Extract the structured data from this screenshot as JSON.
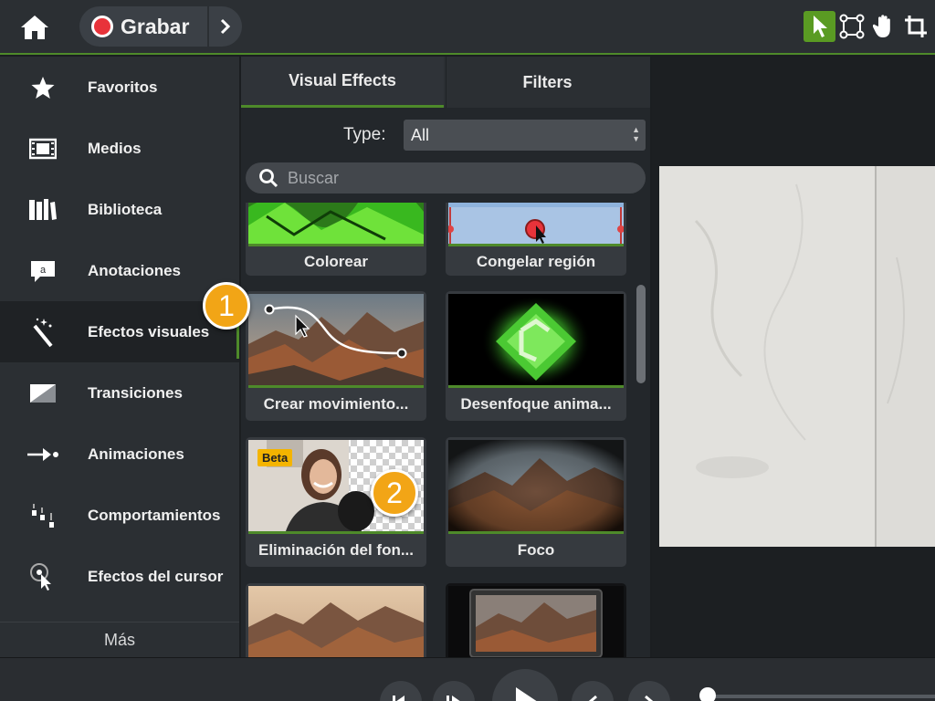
{
  "topbar": {
    "record_label": "Grabar",
    "tools": [
      "pointer-icon",
      "transform-icon",
      "hand-icon",
      "crop-icon"
    ]
  },
  "sidebar": {
    "items": [
      {
        "label": "Favoritos",
        "icon": "star-icon"
      },
      {
        "label": "Medios",
        "icon": "film-icon"
      },
      {
        "label": "Biblioteca",
        "icon": "library-icon"
      },
      {
        "label": "Anotaciones",
        "icon": "annotation-icon"
      },
      {
        "label": "Efectos visuales",
        "icon": "magic-wand-icon",
        "active": true
      },
      {
        "label": "Transiciones",
        "icon": "transition-icon"
      },
      {
        "label": "Animaciones",
        "icon": "animation-icon"
      },
      {
        "label": "Comportamientos",
        "icon": "behaviors-icon"
      },
      {
        "label": "Efectos del cursor",
        "icon": "cursor-effects-icon"
      }
    ],
    "more_label": "Más"
  },
  "panel": {
    "tabs": [
      {
        "label": "Visual Effects",
        "active": true
      },
      {
        "label": "Filters"
      }
    ],
    "type_label": "Type:",
    "type_value": "All",
    "search_placeholder": "Buscar",
    "effects": [
      {
        "label": "Colorear"
      },
      {
        "label": "Congelar región"
      },
      {
        "label": "Crear movimiento..."
      },
      {
        "label": "Desenfoque anima..."
      },
      {
        "label": "Eliminación del fon...",
        "badge": "Beta"
      },
      {
        "label": "Foco"
      },
      {
        "label": ""
      },
      {
        "label": ""
      }
    ]
  },
  "callouts": [
    "1",
    "2"
  ],
  "colors": {
    "accent": "#4e8a2a",
    "record": "#e8333a",
    "callout": "#f2a516"
  }
}
